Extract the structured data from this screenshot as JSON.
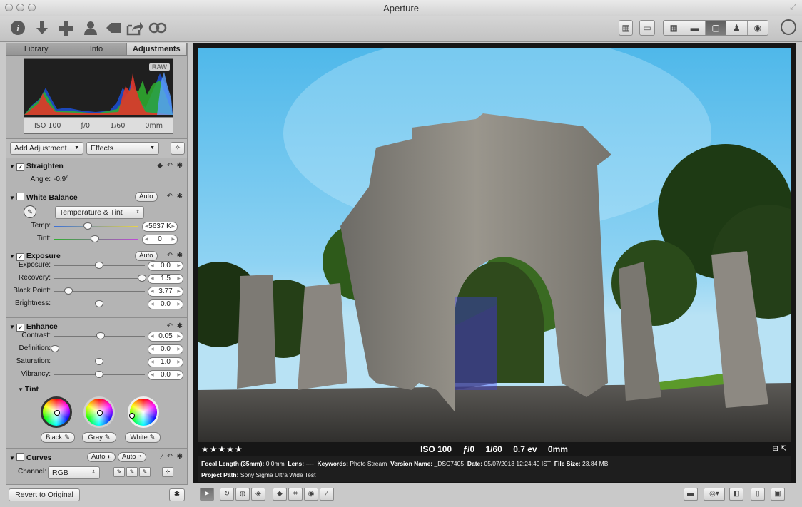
{
  "window": {
    "title": "Aperture"
  },
  "toolbar": {
    "left_icons": [
      "info-icon",
      "import-icon",
      "new-icon",
      "faces-icon",
      "keywords-icon",
      "share-icon",
      "viewer-mode-icon"
    ],
    "layout_buttons": [
      "browser-icon",
      "viewer-icon"
    ],
    "view_modes": [
      "grid-icon",
      "filmstrip-icon",
      "viewer-only-icon",
      "faces-icon",
      "places-icon"
    ]
  },
  "inspector": {
    "tabs": [
      "Library",
      "Info",
      "Adjustments"
    ],
    "selected_tab": "Adjustments",
    "histogram": {
      "badge": "RAW",
      "iso": "ISO 100",
      "aperture": "ƒ/0",
      "shutter": "1/60",
      "focal": "0mm"
    },
    "add_adjustment": "Add Adjustment",
    "effects": "Effects",
    "straighten": {
      "title": "Straighten",
      "angle_label": "Angle:",
      "angle_value": "-0.9°"
    },
    "white_balance": {
      "title": "White Balance",
      "auto": "Auto",
      "mode": "Temperature & Tint",
      "temp_label": "Temp:",
      "temp_value": "5637 K",
      "tint_label": "Tint:",
      "tint_value": "0"
    },
    "exposure": {
      "title": "Exposure",
      "auto": "Auto",
      "rows": [
        {
          "label": "Exposure:",
          "value": "0.0",
          "pos": 0.5
        },
        {
          "label": "Recovery:",
          "value": "1.5",
          "pos": 0.98
        },
        {
          "label": "Black Point:",
          "value": "3.77",
          "pos": 0.15
        },
        {
          "label": "Brightness:",
          "value": "0.0",
          "pos": 0.5
        }
      ]
    },
    "enhance": {
      "title": "Enhance",
      "rows": [
        {
          "label": "Contrast:",
          "value": "0.05",
          "pos": 0.52
        },
        {
          "label": "Definition:",
          "value": "0.0",
          "pos": 0.0
        },
        {
          "label": "Saturation:",
          "value": "1.0",
          "pos": 0.5
        },
        {
          "label": "Vibrancy:",
          "value": "0.0",
          "pos": 0.5
        }
      ],
      "tint_title": "Tint",
      "black": "Black",
      "gray": "Gray",
      "white": "White"
    },
    "curves": {
      "title": "Curves",
      "auto1": "Auto",
      "auto2": "Auto",
      "channel_label": "Channel:",
      "channel_value": "RGB"
    },
    "revert": "Revert to Original"
  },
  "viewer": {
    "rating": "★★★★★",
    "exif": {
      "iso": "ISO 100",
      "aperture": "ƒ/0",
      "shutter": "1/60",
      "ev": "0.7 ev",
      "focal": "0mm"
    },
    "metadata": {
      "focal_label": "Focal Length (35mm):",
      "focal_value": "0.0mm",
      "lens_label": "Lens:",
      "lens_value": "----",
      "keywords_label": "Keywords:",
      "keywords_value": "Photo Stream",
      "version_label": "Version Name:",
      "version_value": "_DSC7405",
      "date_label": "Date:",
      "date_value": "05/07/2013 12:24:49 IST",
      "size_label": "File Size:",
      "size_value": "23.84 MB",
      "project_label": "Project Path:",
      "project_value": "Sony Sigma Ultra Wide Test"
    }
  },
  "bottom_tools": [
    "select-tool-icon",
    "rotate-tool-icon",
    "retouch-tool-icon",
    "lift-stamp-icon",
    "straighten-tool-icon",
    "crop-tool-icon",
    "red-eye-tool-icon",
    "brush-tool-icon"
  ],
  "colors": {
    "panel": "#b4b4b4",
    "viewer_bg": "#161616",
    "sky": "#4fb8ea"
  }
}
